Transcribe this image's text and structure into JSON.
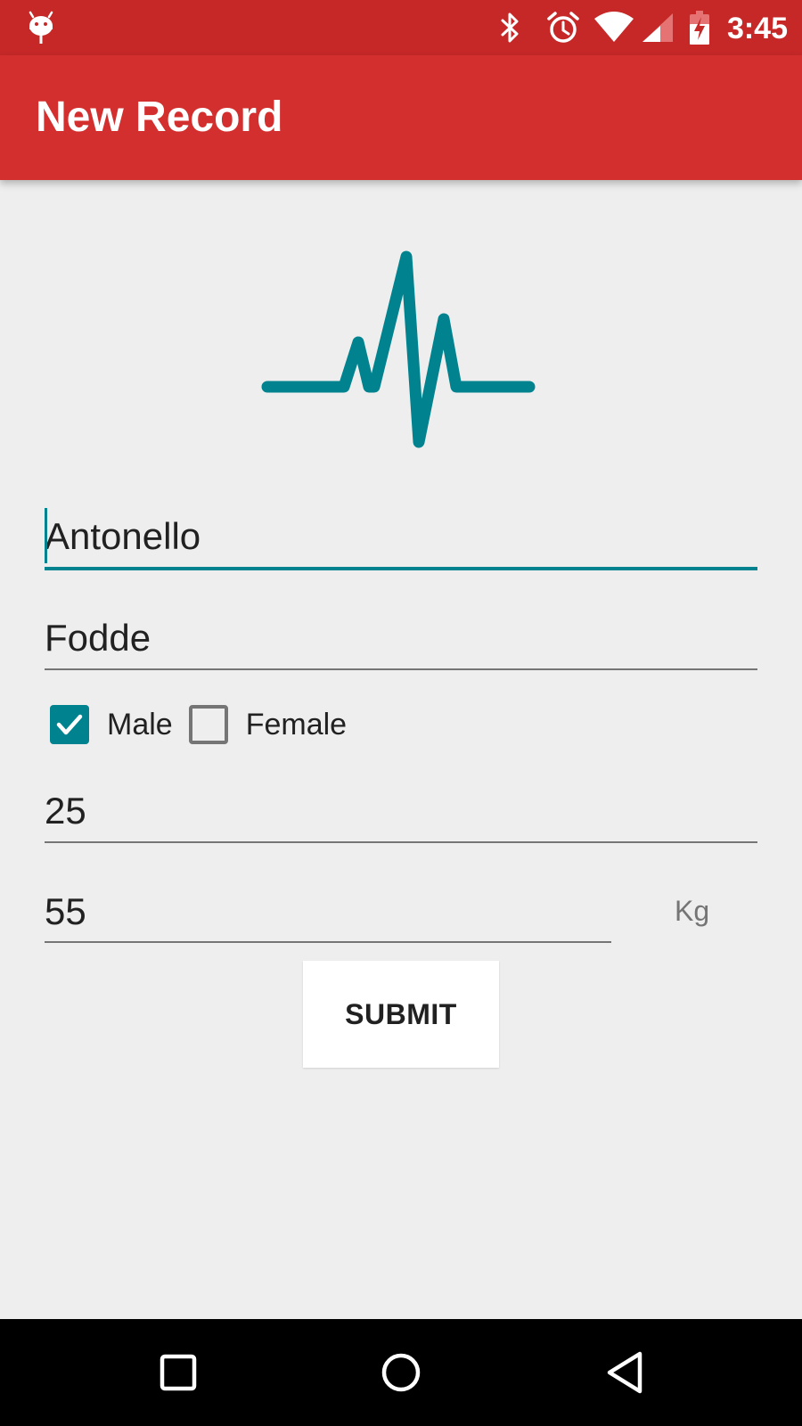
{
  "status_bar": {
    "time": "3:45",
    "icons": [
      "android-debug-icon",
      "bluetooth-icon",
      "alarm-icon",
      "wifi-icon",
      "cell-signal-icon",
      "battery-charging-icon"
    ]
  },
  "toolbar": {
    "title": "New Record"
  },
  "header_icon": "heartbeat-pulse-icon",
  "form": {
    "first_name": "Antonello",
    "last_name": "Fodde",
    "gender": {
      "male_label": "Male",
      "male_checked": true,
      "female_label": "Female",
      "female_checked": false
    },
    "age": "25",
    "weight": "55",
    "weight_unit": "Kg",
    "submit_label": "SUBMIT"
  },
  "nav_bar": {
    "buttons": [
      "recents-square-icon",
      "home-circle-icon",
      "back-triangle-icon"
    ]
  },
  "colors": {
    "status_bar": "#C62828",
    "toolbar": "#D32F2F",
    "accent": "#00838F",
    "background": "#EEEEEE"
  }
}
